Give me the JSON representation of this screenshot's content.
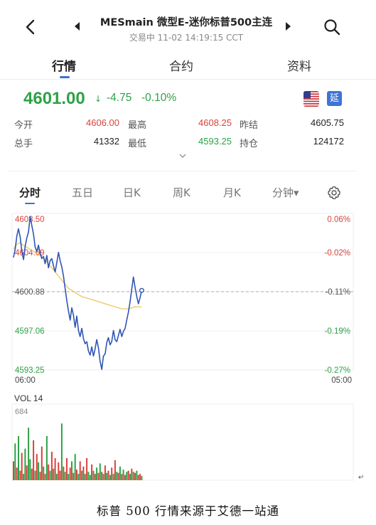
{
  "header": {
    "title": "MESmain 微型E-迷你标普500主连",
    "subtitle": "交易中 11-02 14:19:15 CCT"
  },
  "tabs": [
    "行情",
    "合约",
    "资料"
  ],
  "quote": {
    "price": "4601.00",
    "arrow": "↓",
    "change": "-4.75",
    "change_pct": "-0.10%",
    "badge": "延",
    "flag_icon": "us-flag-icon"
  },
  "stats": {
    "open_label": "今开",
    "open": "4606.00",
    "high_label": "最高",
    "high": "4608.25",
    "prev_close_label": "昨结",
    "prev_close": "4605.75",
    "volume_label": "总手",
    "volume": "41332",
    "low_label": "最低",
    "low": "4593.25",
    "open_interest_label": "持仓",
    "open_interest": "124172"
  },
  "chart_tabs": [
    "分时",
    "五日",
    "日K",
    "周K",
    "月K",
    "分钟▾"
  ],
  "colors": {
    "up": "#d9423c",
    "down": "#2ea147",
    "price_line": "#2f55b5",
    "avg_line": "#e8c252",
    "accent": "#3a6fd8"
  },
  "chart_data": {
    "type": "line",
    "title": "",
    "price_axis_labels": [
      "4608.50",
      "4604.69",
      "4600.88",
      "4597.06",
      "4593.25"
    ],
    "pct_axis_labels": [
      "0.06%",
      "-0.02%",
      "-0.11%",
      "-0.19%",
      "-0.27%"
    ],
    "ylim": [
      4593.25,
      4608.5
    ],
    "x_labels": [
      "06:00",
      "05:00"
    ],
    "session_fraction_elapsed": 0.38,
    "reference_price": 4605.75,
    "last_price": 4601.0,
    "series": [
      {
        "name": "price",
        "values": [
          4604.2,
          4605.0,
          4606.3,
          4607.0,
          4606.2,
          4604.8,
          4604.0,
          4605.3,
          4606.1,
          4606.7,
          4608.2,
          4607.3,
          4606.5,
          4605.2,
          4604.8,
          4605.4,
          4604.6,
          4604.1,
          4604.3,
          4603.6,
          4604.4,
          4603.2,
          4603.9,
          4604.1,
          4603.4,
          4602.8,
          4603.7,
          4604.7,
          4603.9,
          4603.3,
          4602.4,
          4601.2,
          4600.0,
          4599.0,
          4598.1,
          4599.3,
          4598.6,
          4597.4,
          4598.5,
          4597.1,
          4596.5,
          4597.3,
          4596.3,
          4595.8,
          4596.0,
          4595.1,
          4594.7,
          4595.5,
          4594.6,
          4595.3,
          4596.2,
          4595.4,
          4594.1,
          4593.3,
          4594.6,
          4594.8,
          4595.9,
          4596.4,
          4595.7,
          4596.0,
          4597.1,
          4596.2,
          4596.0,
          4596.6,
          4597.2,
          4596.5,
          4597.0,
          4597.3,
          4598.1,
          4598.9,
          4599.9,
          4601.1,
          4602.3,
          4601.3,
          4600.4,
          4599.7,
          4600.3,
          4601.0
        ]
      },
      {
        "name": "avg",
        "values": [
          4605.0,
          4605.3,
          4605.5,
          4605.6,
          4605.6,
          4605.5,
          4605.4,
          4605.3,
          4605.2,
          4605.1,
          4605.0,
          4604.9,
          4604.8,
          4604.7,
          4604.6,
          4604.5,
          4604.4,
          4604.3,
          4604.2,
          4604.0,
          4603.8,
          4603.6,
          4603.4,
          4603.2,
          4603.0,
          4602.8,
          4602.6,
          4602.4,
          4602.2,
          4602.0,
          4601.8,
          4601.6,
          4601.4,
          4601.2,
          4601.1,
          4601.0,
          4600.9,
          4600.8,
          4600.7,
          4600.6,
          4600.5,
          4600.4,
          4600.35,
          4600.3,
          4600.25,
          4600.2,
          4600.15,
          4600.1,
          4600.05,
          4600.0,
          4599.95,
          4599.9,
          4599.85,
          4599.8,
          4599.75,
          4599.7,
          4599.65,
          4599.6,
          4599.55,
          4599.5,
          4599.45,
          4599.4,
          4599.35,
          4599.3,
          4599.25,
          4599.2,
          4599.2,
          4599.2,
          4599.2,
          4599.2,
          4599.25,
          4599.3,
          4599.35,
          4599.4,
          4599.4,
          4599.4,
          4599.4,
          4599.4
        ]
      }
    ],
    "volume": {
      "label": "VOL 14",
      "max_label": "684",
      "max": 684,
      "values": [
        180,
        350,
        120,
        420,
        90,
        260,
        60,
        300,
        140,
        500,
        200,
        110,
        380,
        90,
        250,
        170,
        80,
        320,
        130,
        60,
        420,
        150,
        90,
        270,
        110,
        210,
        60,
        170,
        90,
        540,
        130,
        80,
        210,
        60,
        120,
        180,
        70,
        250,
        100,
        60,
        180,
        90,
        130,
        60,
        210,
        80,
        50,
        150,
        90,
        60,
        120,
        70,
        160,
        80,
        60,
        140,
        70,
        90,
        50,
        120,
        60,
        190,
        80,
        70,
        130,
        60,
        100,
        50,
        80,
        90,
        60,
        110,
        80,
        70,
        90,
        50,
        60,
        40
      ],
      "colors": [
        "r",
        "g",
        "r",
        "g",
        "r",
        "r",
        "g",
        "g",
        "r",
        "g",
        "g",
        "r",
        "r",
        "g",
        "r",
        "g",
        "r",
        "r",
        "g",
        "r",
        "g",
        "r",
        "g",
        "r",
        "g",
        "r",
        "g",
        "r",
        "r",
        "g",
        "r",
        "g",
        "r",
        "g",
        "r",
        "g",
        "r",
        "g",
        "r",
        "g",
        "r",
        "g",
        "r",
        "g",
        "r",
        "g",
        "g",
        "r",
        "g",
        "r",
        "g",
        "r",
        "g",
        "r",
        "g",
        "r",
        "g",
        "r",
        "g",
        "r",
        "g",
        "r",
        "g",
        "r",
        "g",
        "r",
        "g",
        "r",
        "g",
        "r",
        "g",
        "r",
        "g",
        "r",
        "g",
        "r",
        "r",
        "g"
      ]
    }
  },
  "footer": {
    "caption": "标普 500 行情来源于艾德一站通",
    "return_mark": "↵"
  }
}
